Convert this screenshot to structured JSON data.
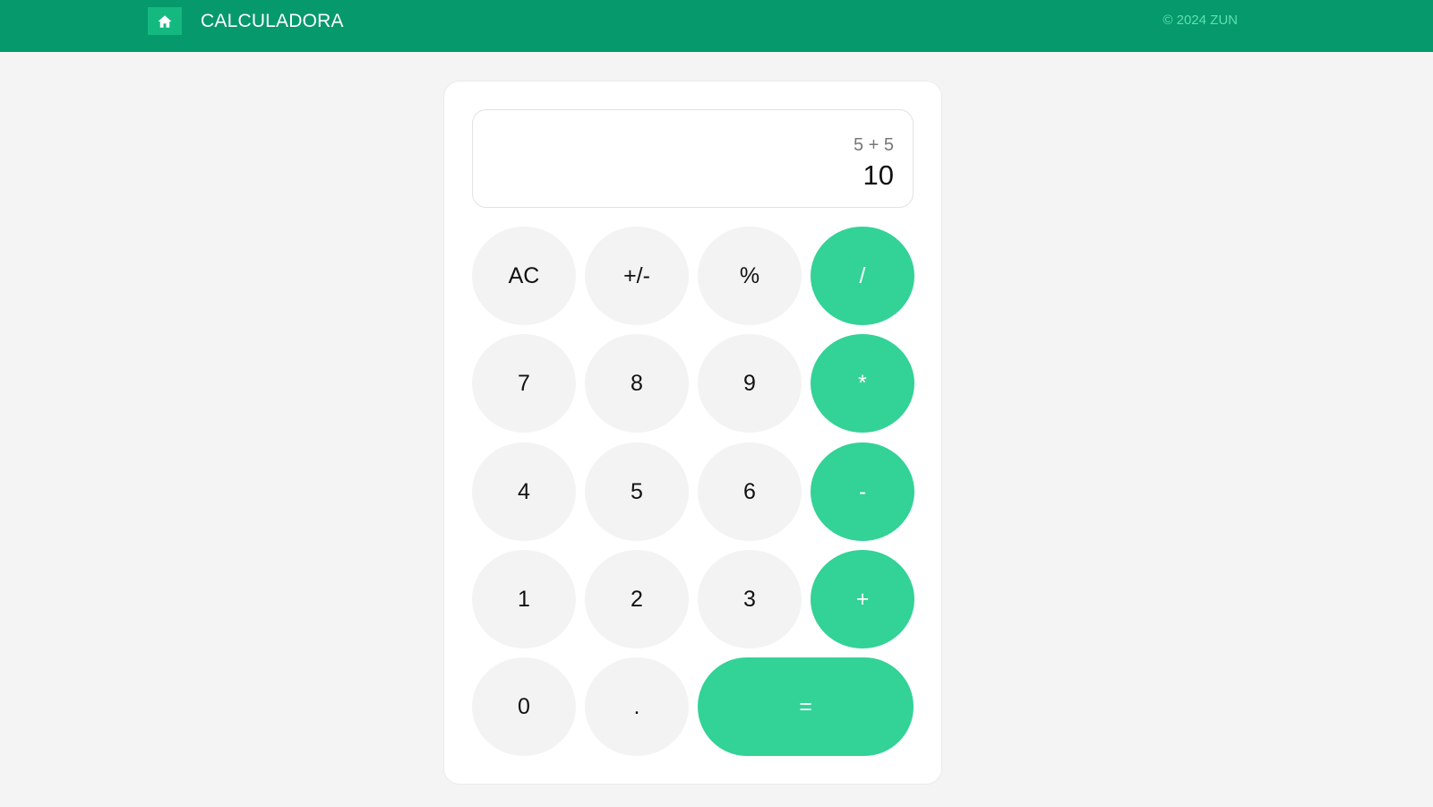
{
  "header": {
    "title": "CALCULADORA",
    "copyright": "© 2024 ZUN",
    "home_icon": "home-icon"
  },
  "display": {
    "expression": "5 + 5",
    "result": "10"
  },
  "keys": {
    "ac": "AC",
    "sign": "+/-",
    "percent": "%",
    "divide": "/",
    "seven": "7",
    "eight": "8",
    "nine": "9",
    "multiply": "*",
    "four": "4",
    "five": "5",
    "six": "6",
    "subtract": "-",
    "one": "1",
    "two": "2",
    "three": "3",
    "add": "+",
    "zero": "0",
    "decimal": ".",
    "equals": "="
  },
  "colors": {
    "header_bg": "#05996b",
    "operator_bg": "#33d297",
    "key_bg": "#f3f3f3"
  }
}
